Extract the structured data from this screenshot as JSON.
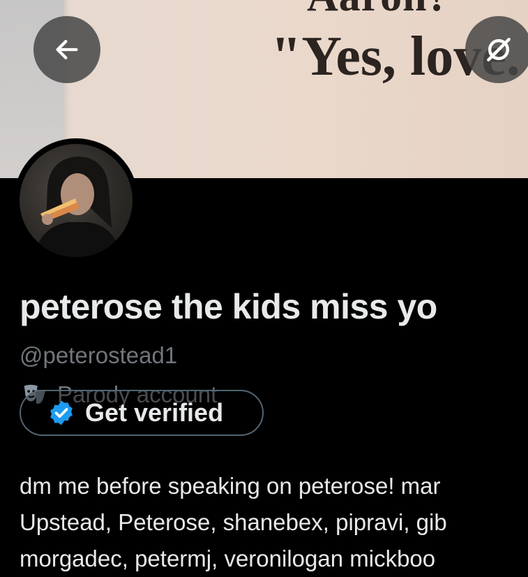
{
  "banner": {
    "line1": "Aaron?",
    "line2": "\"Yes, love."
  },
  "toolbar": {
    "back_icon": "arrow-left-icon",
    "more_icon": "more-icon"
  },
  "profile": {
    "display_name": "peterose the kids miss yo",
    "handle": "@peterostead1",
    "parody_label": "Parody account",
    "get_verified_label": "Get verified",
    "bio_lines": [
      "dm me before speaking on peterose! mar",
      "Upstead, Peterose, shanebex, pipravi, gib",
      "morgadec, petermj, veronilogan mickboo"
    ]
  },
  "colors": {
    "background": "#000000",
    "text_primary": "#e7e9ea",
    "text_secondary": "#71767b",
    "verified_blue": "#1d9bf0"
  }
}
